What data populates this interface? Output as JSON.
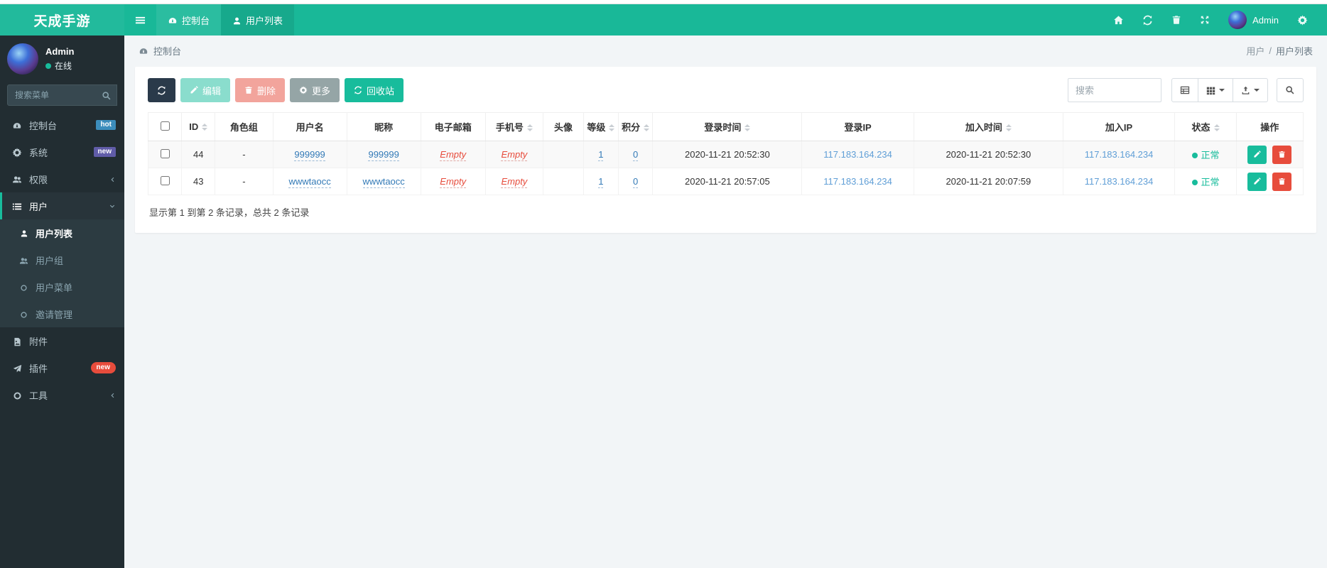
{
  "topbar": {
    "brand": "天成手游",
    "tab_dashboard": "控制台",
    "tab_userlist": "用户列表",
    "username": "Admin"
  },
  "sidebar": {
    "username": "Admin",
    "online_status": "在线",
    "search_placeholder": "搜索菜单",
    "menu": {
      "dashboard": "控制台",
      "dashboard_badge": "hot",
      "system": "系统",
      "system_badge": "new",
      "auth": "权限",
      "user": "用户",
      "user_list": "用户列表",
      "user_group": "用户组",
      "user_menu": "用户菜单",
      "invite": "邀请管理",
      "attachment": "附件",
      "addon": "插件",
      "addon_badge": "new",
      "tools": "工具"
    }
  },
  "breadcrumb": {
    "current": "控制台",
    "trail_parent": "用户",
    "trail_sep": "/",
    "trail_current": "用户列表"
  },
  "toolbar": {
    "edit": "编辑",
    "delete": "删除",
    "more": "更多",
    "recycle": "回收站",
    "search_placeholder": "搜索"
  },
  "table": {
    "headers": {
      "id": "ID",
      "rolegroup": "角色组",
      "username": "用户名",
      "nickname": "昵称",
      "email": "电子邮箱",
      "mobile": "手机号",
      "avatar": "头像",
      "level": "等级",
      "score": "积分",
      "login_time": "登录时间",
      "login_ip": "登录IP",
      "join_time": "加入时间",
      "join_ip": "加入IP",
      "status": "状态",
      "op": "操作"
    },
    "rows": [
      {
        "id": "44",
        "rolegroup": "-",
        "username": "999999",
        "nickname": "999999",
        "email": "Empty",
        "mobile": "Empty",
        "level": "1",
        "score": "0",
        "login_time": "2020-11-21 20:52:30",
        "login_ip": "117.183.164.234",
        "join_time": "2020-11-21 20:52:30",
        "join_ip": "117.183.164.234",
        "status": "正常"
      },
      {
        "id": "43",
        "rolegroup": "-",
        "username": "wwwtaocc",
        "nickname": "wwwtaocc",
        "email": "Empty",
        "mobile": "Empty",
        "level": "1",
        "score": "0",
        "login_time": "2020-11-21 20:57:05",
        "login_ip": "117.183.164.234",
        "join_time": "2020-11-21 20:07:59",
        "join_ip": "117.183.164.234",
        "status": "正常"
      }
    ],
    "summary": "显示第 1 到第 2 条记录，总共 2 条记录"
  },
  "colors": {
    "topbar": "#19b898",
    "accent": "#18bc9c",
    "sidebar_bg": "#222d32",
    "submenu_bg": "#2c3b41",
    "badge_hot": "#3c8dbc",
    "badge_new_purple": "#605ca8",
    "badge_new_red": "#e74c3c",
    "link": "#337ab7",
    "empty_text": "#e74c3c",
    "ip_link": "#5f9ed6",
    "status_ok": "#18bc9c",
    "btn_dark": "#2a3a4a",
    "btn_gray": "#95a5a6",
    "btn_danger": "#e74c3c"
  }
}
